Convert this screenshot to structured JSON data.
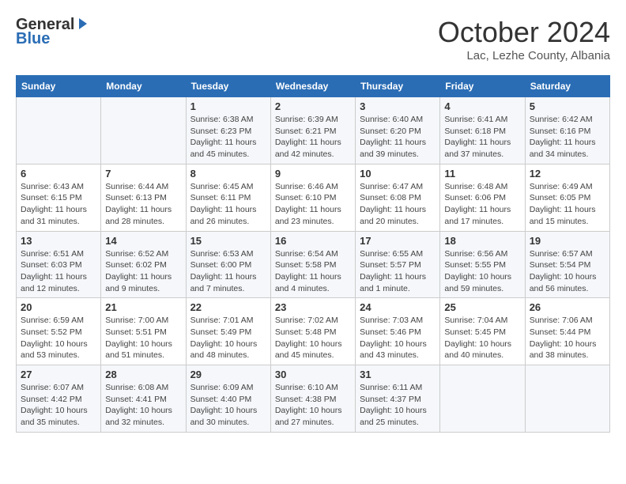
{
  "header": {
    "logo_general": "General",
    "logo_blue": "Blue",
    "month_title": "October 2024",
    "location": "Lac, Lezhe County, Albania"
  },
  "columns": [
    "Sunday",
    "Monday",
    "Tuesday",
    "Wednesday",
    "Thursday",
    "Friday",
    "Saturday"
  ],
  "weeks": [
    [
      {
        "day": "",
        "sunrise": "",
        "sunset": "",
        "daylight": ""
      },
      {
        "day": "",
        "sunrise": "",
        "sunset": "",
        "daylight": ""
      },
      {
        "day": "1",
        "sunrise": "Sunrise: 6:38 AM",
        "sunset": "Sunset: 6:23 PM",
        "daylight": "Daylight: 11 hours and 45 minutes."
      },
      {
        "day": "2",
        "sunrise": "Sunrise: 6:39 AM",
        "sunset": "Sunset: 6:21 PM",
        "daylight": "Daylight: 11 hours and 42 minutes."
      },
      {
        "day": "3",
        "sunrise": "Sunrise: 6:40 AM",
        "sunset": "Sunset: 6:20 PM",
        "daylight": "Daylight: 11 hours and 39 minutes."
      },
      {
        "day": "4",
        "sunrise": "Sunrise: 6:41 AM",
        "sunset": "Sunset: 6:18 PM",
        "daylight": "Daylight: 11 hours and 37 minutes."
      },
      {
        "day": "5",
        "sunrise": "Sunrise: 6:42 AM",
        "sunset": "Sunset: 6:16 PM",
        "daylight": "Daylight: 11 hours and 34 minutes."
      }
    ],
    [
      {
        "day": "6",
        "sunrise": "Sunrise: 6:43 AM",
        "sunset": "Sunset: 6:15 PM",
        "daylight": "Daylight: 11 hours and 31 minutes."
      },
      {
        "day": "7",
        "sunrise": "Sunrise: 6:44 AM",
        "sunset": "Sunset: 6:13 PM",
        "daylight": "Daylight: 11 hours and 28 minutes."
      },
      {
        "day": "8",
        "sunrise": "Sunrise: 6:45 AM",
        "sunset": "Sunset: 6:11 PM",
        "daylight": "Daylight: 11 hours and 26 minutes."
      },
      {
        "day": "9",
        "sunrise": "Sunrise: 6:46 AM",
        "sunset": "Sunset: 6:10 PM",
        "daylight": "Daylight: 11 hours and 23 minutes."
      },
      {
        "day": "10",
        "sunrise": "Sunrise: 6:47 AM",
        "sunset": "Sunset: 6:08 PM",
        "daylight": "Daylight: 11 hours and 20 minutes."
      },
      {
        "day": "11",
        "sunrise": "Sunrise: 6:48 AM",
        "sunset": "Sunset: 6:06 PM",
        "daylight": "Daylight: 11 hours and 17 minutes."
      },
      {
        "day": "12",
        "sunrise": "Sunrise: 6:49 AM",
        "sunset": "Sunset: 6:05 PM",
        "daylight": "Daylight: 11 hours and 15 minutes."
      }
    ],
    [
      {
        "day": "13",
        "sunrise": "Sunrise: 6:51 AM",
        "sunset": "Sunset: 6:03 PM",
        "daylight": "Daylight: 11 hours and 12 minutes."
      },
      {
        "day": "14",
        "sunrise": "Sunrise: 6:52 AM",
        "sunset": "Sunset: 6:02 PM",
        "daylight": "Daylight: 11 hours and 9 minutes."
      },
      {
        "day": "15",
        "sunrise": "Sunrise: 6:53 AM",
        "sunset": "Sunset: 6:00 PM",
        "daylight": "Daylight: 11 hours and 7 minutes."
      },
      {
        "day": "16",
        "sunrise": "Sunrise: 6:54 AM",
        "sunset": "Sunset: 5:58 PM",
        "daylight": "Daylight: 11 hours and 4 minutes."
      },
      {
        "day": "17",
        "sunrise": "Sunrise: 6:55 AM",
        "sunset": "Sunset: 5:57 PM",
        "daylight": "Daylight: 11 hours and 1 minute."
      },
      {
        "day": "18",
        "sunrise": "Sunrise: 6:56 AM",
        "sunset": "Sunset: 5:55 PM",
        "daylight": "Daylight: 10 hours and 59 minutes."
      },
      {
        "day": "19",
        "sunrise": "Sunrise: 6:57 AM",
        "sunset": "Sunset: 5:54 PM",
        "daylight": "Daylight: 10 hours and 56 minutes."
      }
    ],
    [
      {
        "day": "20",
        "sunrise": "Sunrise: 6:59 AM",
        "sunset": "Sunset: 5:52 PM",
        "daylight": "Daylight: 10 hours and 53 minutes."
      },
      {
        "day": "21",
        "sunrise": "Sunrise: 7:00 AM",
        "sunset": "Sunset: 5:51 PM",
        "daylight": "Daylight: 10 hours and 51 minutes."
      },
      {
        "day": "22",
        "sunrise": "Sunrise: 7:01 AM",
        "sunset": "Sunset: 5:49 PM",
        "daylight": "Daylight: 10 hours and 48 minutes."
      },
      {
        "day": "23",
        "sunrise": "Sunrise: 7:02 AM",
        "sunset": "Sunset: 5:48 PM",
        "daylight": "Daylight: 10 hours and 45 minutes."
      },
      {
        "day": "24",
        "sunrise": "Sunrise: 7:03 AM",
        "sunset": "Sunset: 5:46 PM",
        "daylight": "Daylight: 10 hours and 43 minutes."
      },
      {
        "day": "25",
        "sunrise": "Sunrise: 7:04 AM",
        "sunset": "Sunset: 5:45 PM",
        "daylight": "Daylight: 10 hours and 40 minutes."
      },
      {
        "day": "26",
        "sunrise": "Sunrise: 7:06 AM",
        "sunset": "Sunset: 5:44 PM",
        "daylight": "Daylight: 10 hours and 38 minutes."
      }
    ],
    [
      {
        "day": "27",
        "sunrise": "Sunrise: 6:07 AM",
        "sunset": "Sunset: 4:42 PM",
        "daylight": "Daylight: 10 hours and 35 minutes."
      },
      {
        "day": "28",
        "sunrise": "Sunrise: 6:08 AM",
        "sunset": "Sunset: 4:41 PM",
        "daylight": "Daylight: 10 hours and 32 minutes."
      },
      {
        "day": "29",
        "sunrise": "Sunrise: 6:09 AM",
        "sunset": "Sunset: 4:40 PM",
        "daylight": "Daylight: 10 hours and 30 minutes."
      },
      {
        "day": "30",
        "sunrise": "Sunrise: 6:10 AM",
        "sunset": "Sunset: 4:38 PM",
        "daylight": "Daylight: 10 hours and 27 minutes."
      },
      {
        "day": "31",
        "sunrise": "Sunrise: 6:11 AM",
        "sunset": "Sunset: 4:37 PM",
        "daylight": "Daylight: 10 hours and 25 minutes."
      },
      {
        "day": "",
        "sunrise": "",
        "sunset": "",
        "daylight": ""
      },
      {
        "day": "",
        "sunrise": "",
        "sunset": "",
        "daylight": ""
      }
    ]
  ]
}
